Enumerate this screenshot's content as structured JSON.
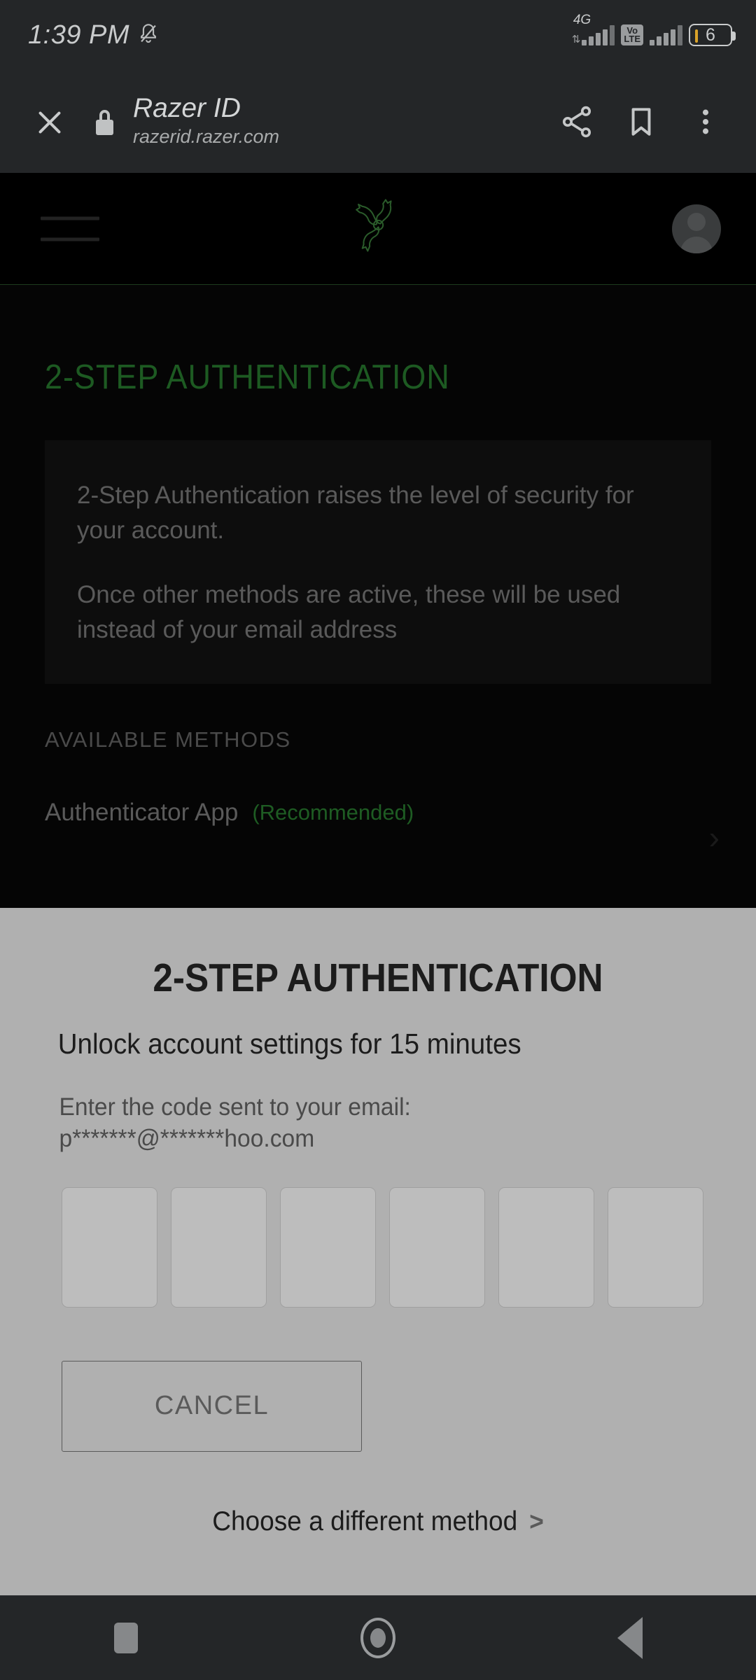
{
  "status_bar": {
    "clock": "1:39 PM",
    "notification_icon": "bell-muted-icon",
    "network_label": "4G",
    "volte_line1": "Vo",
    "volte_line2": "LTE",
    "battery_level": "6"
  },
  "browser_toolbar": {
    "close_icon": "close-icon",
    "lock_icon": "lock-icon",
    "title": "Razer ID",
    "url": "razerid.razer.com",
    "share_icon": "share-icon",
    "bookmark_icon": "bookmark-icon",
    "overflow_icon": "more-vertical-icon"
  },
  "site_header": {
    "menu_icon": "hamburger-menu-icon",
    "logo": "razer-snake-logo",
    "avatar": "user-avatar-icon"
  },
  "page": {
    "heading": "2-STEP AUTHENTICATION",
    "info_card": {
      "paragraph_1": "2-Step Authentication raises the level of security for your account.",
      "paragraph_2": "Once other methods are active, these will be used instead of your email address"
    },
    "section_label": "AVAILABLE METHODS",
    "methods": [
      {
        "name": "Authenticator App",
        "badge": "(Recommended)",
        "chevron": "›"
      }
    ]
  },
  "sheet": {
    "title": "2-STEP AUTHENTICATION",
    "subtitle": "Unlock account settings for 15 minutes",
    "note_line_1": "Enter the code sent to your email:",
    "note_line_2": "p*******@*******hoo.com",
    "otp": {
      "length": 6,
      "values": [
        "",
        "",
        "",
        "",
        "",
        ""
      ],
      "placeholder": ""
    },
    "cancel_label": "CANCEL",
    "different_method_label": "Choose a different method",
    "different_method_chevron": ">"
  },
  "nav_bar": {
    "recents_icon": "square-recents-icon",
    "home_icon": "circle-home-icon",
    "back_icon": "triangle-back-icon"
  },
  "colors": {
    "razer_green": "#44d62c",
    "sheet_background": "#b0b0b0",
    "toolbar_background": "#242628",
    "battery_accent": "#d9a229"
  }
}
